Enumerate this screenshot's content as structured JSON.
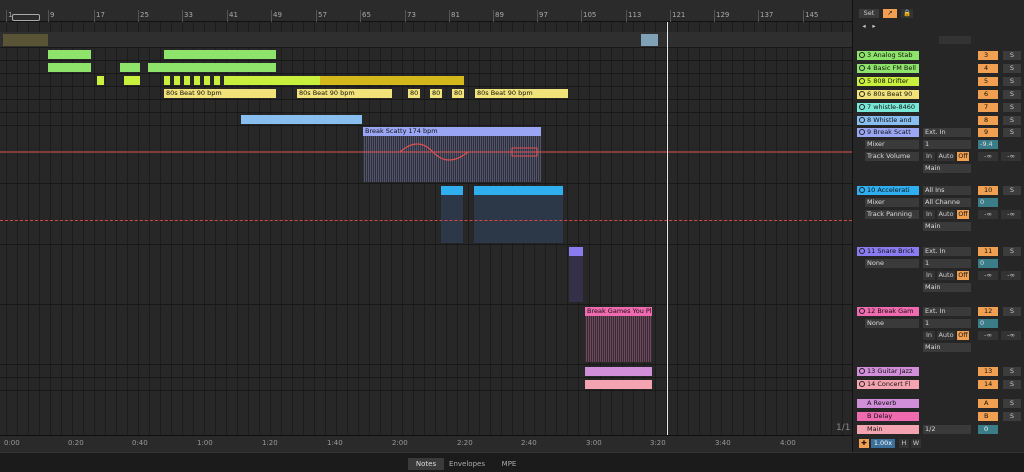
{
  "ruler": {
    "bars": [
      "1",
      "9",
      "17",
      "25",
      "33",
      "41",
      "49",
      "57",
      "65",
      "73",
      "81",
      "89",
      "97",
      "105",
      "113",
      "121",
      "129",
      "137",
      "145"
    ],
    "loop_icon": "loop-brace-icon"
  },
  "clips": {
    "analog": [],
    "fm": [],
    "drifter": [],
    "beats": [
      "80s Beat 90 bpm",
      "80s Beat 90 bpm",
      "80",
      "80",
      "80",
      "80s Beat 90 bpm"
    ],
    "break_scatty": "Break Scatty 174 bpm",
    "break_games": "Break Games You Pl"
  },
  "timeline": {
    "times": [
      "0:00",
      "0:20",
      "0:40",
      "1:00",
      "1:20",
      "1:40",
      "2:00",
      "2:20",
      "2:40",
      "3:00",
      "3:20",
      "3:40",
      "4:00"
    ],
    "page": "1/1"
  },
  "bottom_tabs": [
    "Notes",
    "Envelopes",
    "MPE"
  ],
  "header": {
    "set_label": "Set"
  },
  "tracks": [
    {
      "name": "3 Analog Stab",
      "num": "3",
      "color": "#8ee46a",
      "solo": "S"
    },
    {
      "name": "4 Basic FM Bell",
      "num": "4",
      "color": "#8ee46a",
      "solo": "S"
    },
    {
      "name": "5 808 Drifter",
      "num": "5",
      "color": "#c9f03c",
      "solo": "S"
    },
    {
      "name": "6 80s Beat 90",
      "num": "6",
      "color": "#f1e27a",
      "solo": "S"
    },
    {
      "name": "7 whistle-8460",
      "num": "7",
      "color": "#78e8d8",
      "solo": "S"
    },
    {
      "name": "8 Whistle and",
      "num": "8",
      "color": "#89bff0",
      "solo": "S"
    },
    {
      "name": "9 Break Scatt",
      "num": "9",
      "color": "#9aa6f4",
      "solo": "S",
      "input": "Ext. In",
      "channel": "1",
      "mixer": "Mixer",
      "device": "Track Volume",
      "vol": "-9.4",
      "out": "Main",
      "in": "In",
      "auto": "Auto",
      "off": "Off",
      "inf": "-∞"
    },
    {
      "name": "10 Accelerati",
      "num": "10",
      "color": "#30aff0",
      "solo": "S",
      "input": "All Ins",
      "channel": "All Channe",
      "mixer": "Mixer",
      "device": "Track Panning",
      "vol": "0",
      "out": "Main",
      "in": "In",
      "auto": "Auto",
      "off": "Off",
      "inf": "-∞"
    },
    {
      "name": "11 Snare Brick",
      "num": "11",
      "color": "#8a7cf0",
      "solo": "S",
      "input": "Ext. In",
      "channel": "1",
      "mixer": "None",
      "vol": "0",
      "out": "Main",
      "in": "In",
      "auto": "Auto",
      "off": "Off",
      "inf": "-∞"
    },
    {
      "name": "12 Break Gam",
      "num": "12",
      "color": "#f06ab0",
      "solo": "S",
      "input": "Ext. In",
      "channel": "1",
      "mixer": "None",
      "vol": "0",
      "out": "Main",
      "in": "In",
      "auto": "Auto",
      "off": "Off",
      "inf": "-∞"
    },
    {
      "name": "13 Guitar Jazz",
      "num": "13",
      "color": "#d18fd9",
      "solo": "S"
    },
    {
      "name": "14 Concert Fl",
      "num": "14",
      "color": "#f4a4b0",
      "solo": "S"
    }
  ],
  "returns": [
    {
      "name": "A Reverb",
      "num": "A",
      "color": "#d18fd9",
      "solo": "S"
    },
    {
      "name": "B Delay",
      "num": "B",
      "color": "#f06ab0",
      "solo": "S"
    },
    {
      "name": "Main",
      "num": "0",
      "color": "#f4a4b0",
      "sel": "1/2"
    }
  ],
  "footer": {
    "zoom": "1.00x",
    "h": "H",
    "w": "W"
  }
}
